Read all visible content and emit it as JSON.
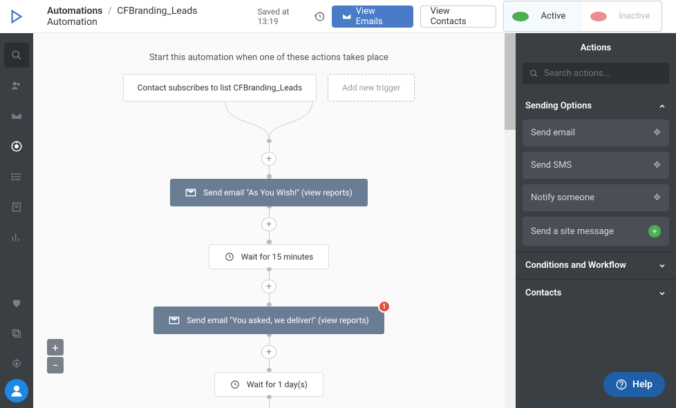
{
  "breadcrumb": {
    "root": "Automations",
    "sep": "/",
    "name": "CFBranding_Leads Automation"
  },
  "saved": "Saved at 13:19",
  "buttons": {
    "view_emails": "View Emails",
    "view_contacts": "View Contacts"
  },
  "status": {
    "active": "Active",
    "inactive": "Inactive"
  },
  "flow": {
    "start_label": "Start this automation when one of these actions takes place",
    "trigger1": "Contact subscribes to list CFBranding_Leads",
    "trigger2": "Add new trigger",
    "email1": "Send email \"As You Wish!\" (view reports)",
    "wait1": "Wait for 15 minutes",
    "email2": "Send email \"You asked, we deliver!\" (view reports)",
    "badge": "1",
    "wait2": "Wait for 1 day(s)"
  },
  "panel": {
    "title": "Actions",
    "search_placeholder": "Search actions...",
    "s1": "Sending Options",
    "a1": "Send email",
    "a2": "Send SMS",
    "a3": "Notify someone",
    "a4": "Send a site message",
    "s2": "Conditions and Workflow",
    "s3": "Contacts"
  },
  "help": "Help"
}
